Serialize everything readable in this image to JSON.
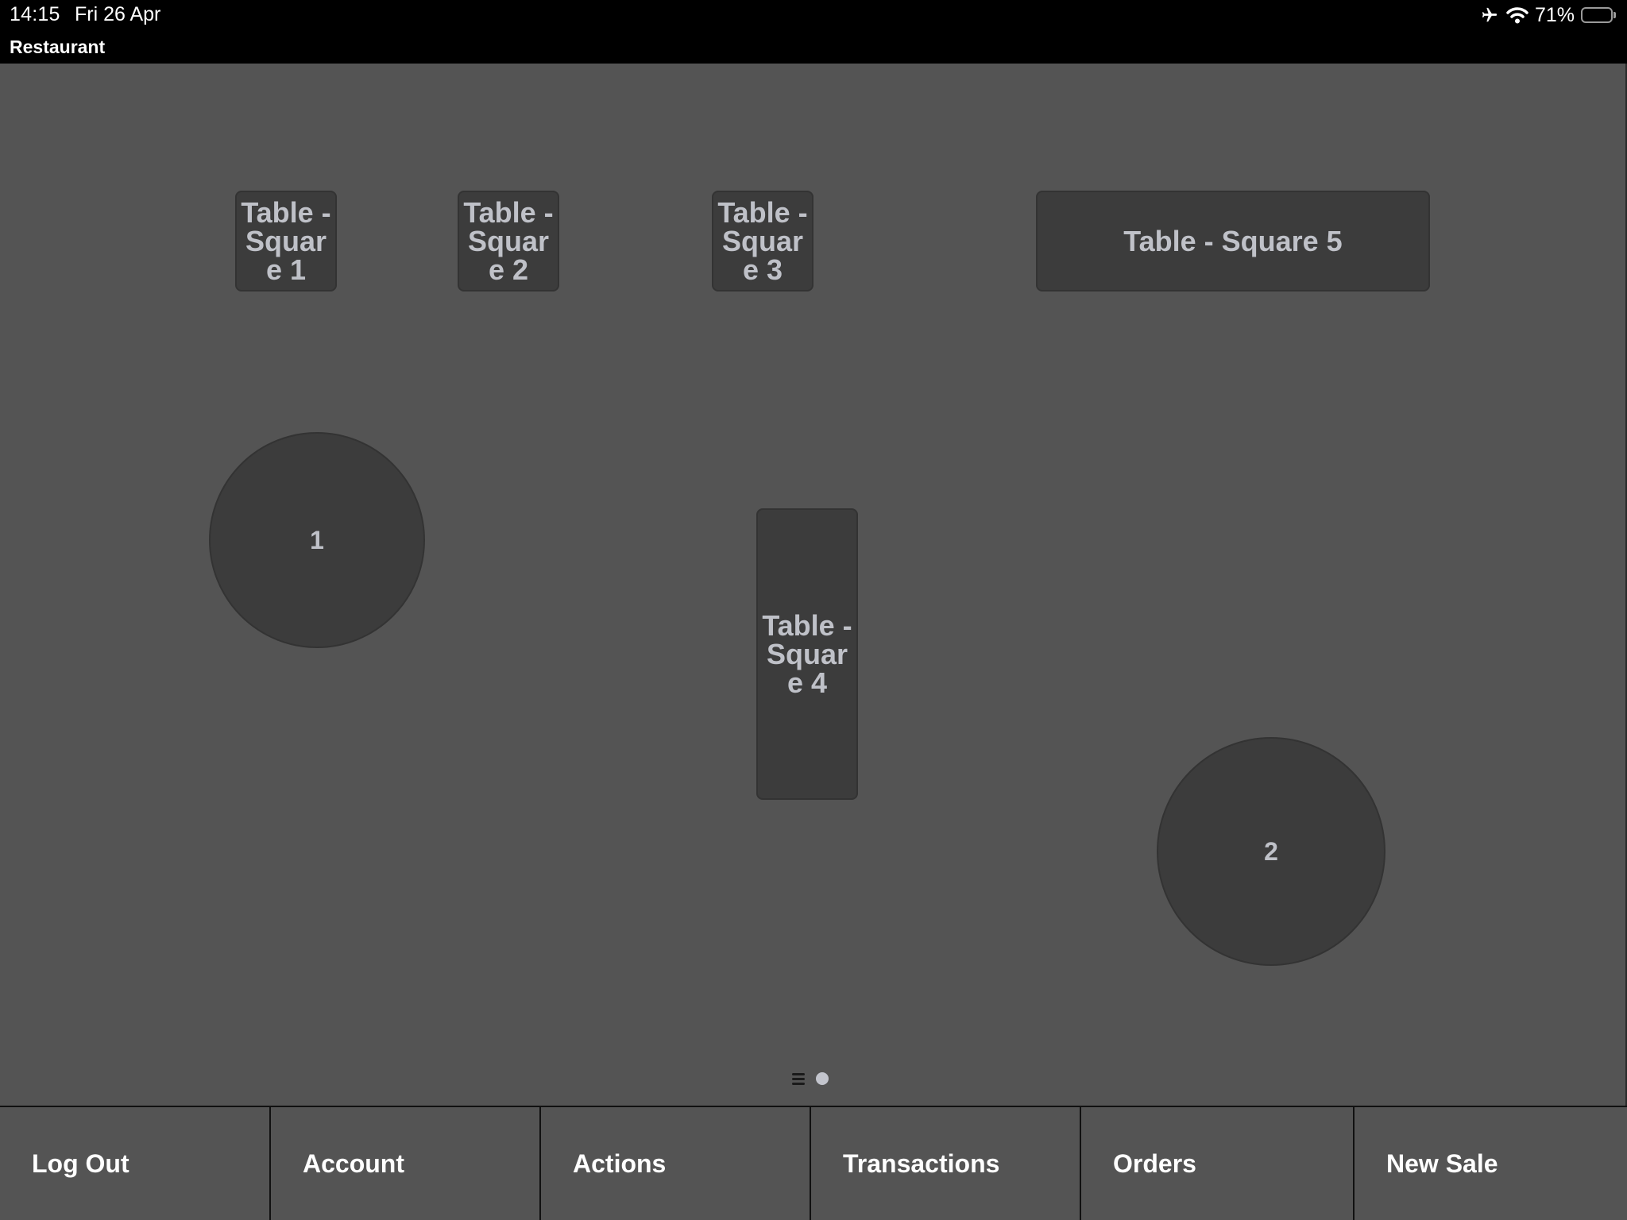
{
  "status_bar": {
    "time": "14:15",
    "date": "Fri 26 Apr",
    "battery_percent": "71%",
    "battery_level": 0.71,
    "icons": [
      "airplane-mode-icon",
      "wifi-icon",
      "battery-icon"
    ]
  },
  "app": {
    "title": "Restaurant"
  },
  "floor_plan": {
    "tables": [
      {
        "id": "sq1",
        "shape": "square",
        "label": "Table - Square 1"
      },
      {
        "id": "sq2",
        "shape": "square",
        "label": "Table - Square 2"
      },
      {
        "id": "sq3",
        "shape": "square",
        "label": "Table - Square 3"
      },
      {
        "id": "sq5",
        "shape": "square",
        "label": "Table - Square 5"
      },
      {
        "id": "r1",
        "shape": "round",
        "label": "1"
      },
      {
        "id": "sq4",
        "shape": "square",
        "label": "Table - Square 4"
      },
      {
        "id": "r2",
        "shape": "round",
        "label": "2"
      }
    ],
    "pager": {
      "pages": 2,
      "current": 2,
      "icons": [
        "list-view-icon",
        "page-dot-icon"
      ]
    }
  },
  "toolbar": {
    "buttons": [
      {
        "label": "Log Out"
      },
      {
        "label": "Account"
      },
      {
        "label": "Actions"
      },
      {
        "label": "Transactions"
      },
      {
        "label": "Orders"
      },
      {
        "label": "New Sale"
      }
    ]
  },
  "colors": {
    "background": "#545454",
    "table_fill": "#3c3c3c",
    "table_text": "#bfc1c8",
    "status_bar": "#000000",
    "toolbar_text": "#ffffff"
  }
}
